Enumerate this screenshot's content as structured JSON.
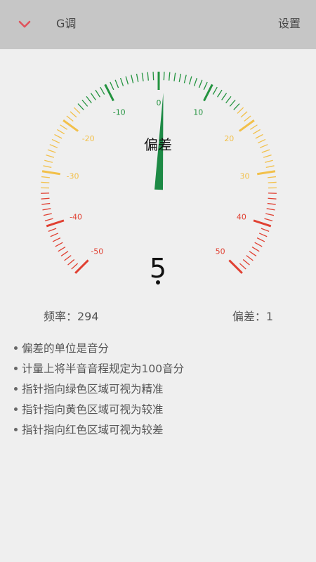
{
  "header": {
    "title": "G调",
    "settings_label": "设置",
    "back_icon": "chevron-down-icon",
    "accent_color": "#e0525b"
  },
  "gauge": {
    "center_label": "偏差",
    "reading": "5",
    "needle_value": 1,
    "scale_labels": [
      "-50",
      "-40",
      "-30",
      "-20",
      "-10",
      "0",
      "10",
      "20",
      "30",
      "40",
      "50"
    ],
    "zone_colors": {
      "green": "#23933f",
      "yellow": "#f2c04a",
      "red": "#e04032"
    }
  },
  "stats": {
    "frequency_label": "频率：294",
    "deviation_label": "偏差：1"
  },
  "notes": [
    "偏差的单位是音分",
    "计量上将半音音程规定为100音分",
    "指针指向绿色区域可视为精准",
    "指针指向黄色区域可视为较准",
    "指针指向红色区域可视为较差"
  ]
}
